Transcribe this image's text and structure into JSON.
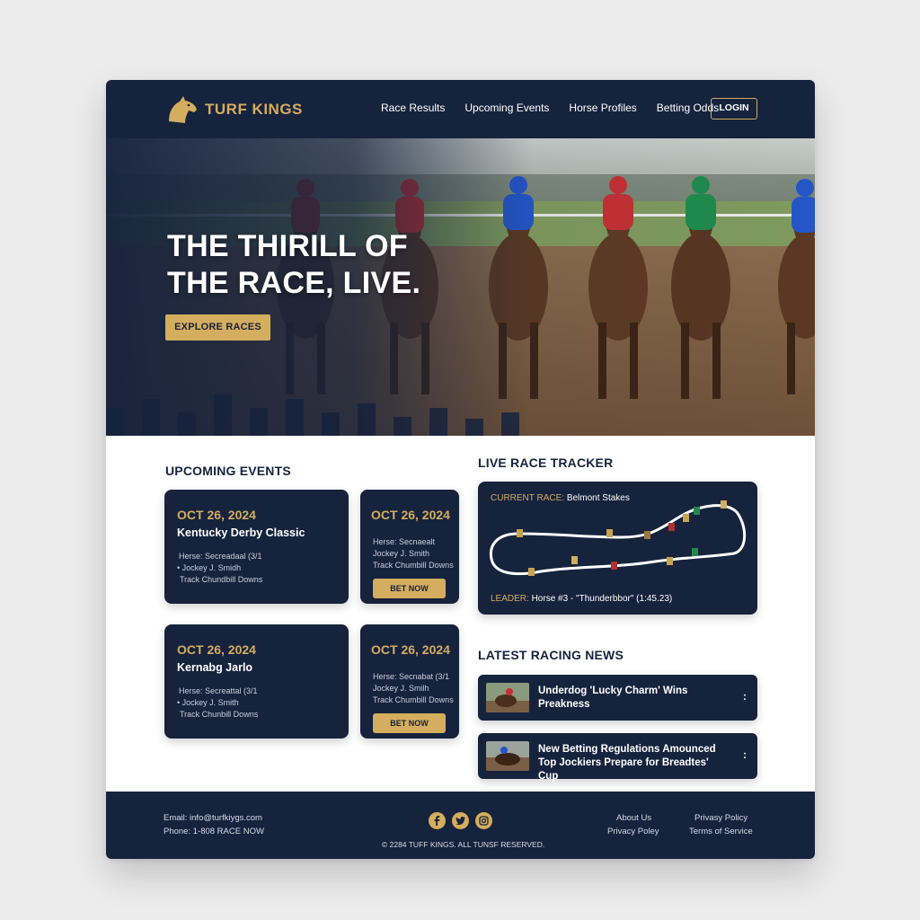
{
  "brand": {
    "name": "TURF KINGS",
    "gold": "#d4ad5e",
    "navy": "#16233d"
  },
  "nav": {
    "links": [
      "Race Results",
      "Upcoming Events",
      "Horse Profiles",
      "Betting Odds"
    ],
    "login": "LOGIN"
  },
  "hero": {
    "title_line1": "THE THIRILL OF",
    "title_line2": "THE RACE, LIVE.",
    "cta": "EXPLORE RACES"
  },
  "upcoming": {
    "title": "UPCOMING EVENTS",
    "cards": [
      {
        "date": "OCT 26, 2024",
        "name": "Kentucky Derby Classic",
        "lines": [
          "Herse: Secreadaal (3/1",
          "• Jockey J. Smidh",
          "Track Chundbill Downs"
        ]
      },
      {
        "date": "OCT 26, 2024",
        "lines": [
          "Herse: Secnaealt",
          "Jockey J. Smith",
          "Track Chumbill Downs"
        ],
        "bet": "BET NOW"
      },
      {
        "date": "OCT 26, 2024",
        "name": "Kernabg Jarlo",
        "lines": [
          "Herse: Secreattal (3/1",
          "• Jockey J. Smith",
          "Track Chunbill Downs"
        ]
      },
      {
        "date": "OCT 26, 2024",
        "lines": [
          "Herse: Secnabat (3/1",
          "Jockey J. Smilh",
          "Track Chumbill Downs"
        ],
        "bet": "BET NOW"
      }
    ]
  },
  "tracker": {
    "title": "LIVE RACE TRACKER",
    "current_label": "CURRENT RACE:",
    "current_value": "Belmont Stakes",
    "leader_label": "LEADER:",
    "leader_value": "Horse #3 - \"Thunderbbor\" (1:45.23)"
  },
  "news": {
    "title": "LATEST RACING NEWS",
    "items": [
      {
        "headline": "Underdog 'Lucky Charm' Wins Preakness",
        "more": ":"
      },
      {
        "headline": "New Betting Regulations Amounced Top Jockiers Prepare for Breadtes' Cup",
        "more": ":"
      }
    ]
  },
  "footer": {
    "email": "Email: info@turfkiygs.com",
    "phone": "Phone: 1-808 RACE NOW",
    "copyright": "© 2284 TUFF KINGS. ALL TUNSF RESERVED.",
    "links": [
      "About Us",
      "Privacy Poley",
      "Privasy Policy",
      "Terms of Service"
    ],
    "social_icons": [
      "facebook-icon",
      "twitter-icon",
      "instagram-icon"
    ]
  }
}
